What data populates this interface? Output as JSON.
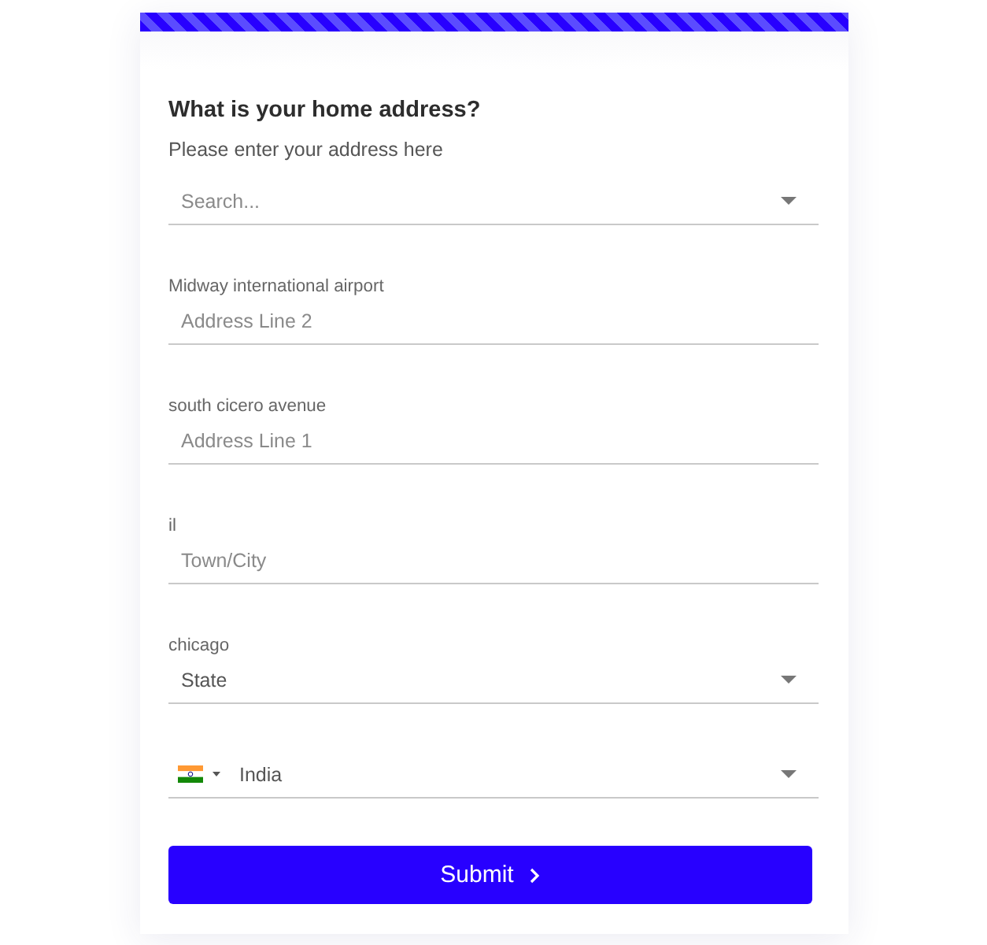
{
  "form": {
    "title": "What is your home address?",
    "subtitle": "Please enter your address here",
    "fields": [
      {
        "kind": "select",
        "placeholder": "Search..."
      },
      {
        "kind": "text",
        "label": "Midway international airport",
        "placeholder": "Address Line 2"
      },
      {
        "kind": "text",
        "label": "south cicero avenue",
        "placeholder": "Address Line 1"
      },
      {
        "kind": "text",
        "label": "il",
        "placeholder": "Town/City"
      },
      {
        "kind": "select",
        "label": "chicago",
        "value": "State"
      },
      {
        "kind": "country",
        "value": "India"
      }
    ],
    "submit": {
      "label": "Submit"
    }
  }
}
